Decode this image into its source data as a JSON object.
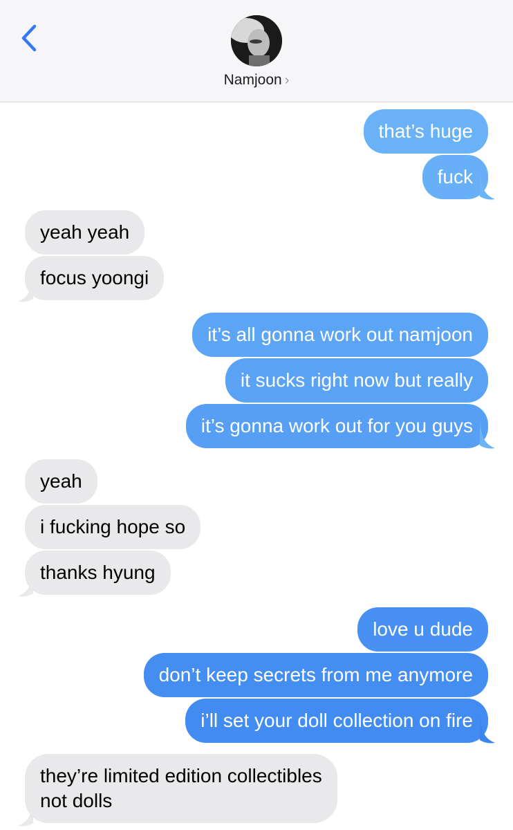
{
  "header": {
    "contact_name": "Namjoon",
    "chevron": "›",
    "back_icon": "chevron-left-icon",
    "accent": "#3478f6",
    "background": "#f6f6f8"
  },
  "colors": {
    "outgoing_top": "#6cb4f7",
    "outgoing_bottom": "#3a84f0",
    "incoming": "#e9e9eb"
  },
  "messages": [
    {
      "from": "me",
      "text": "that’s huge"
    },
    {
      "from": "me",
      "text": "fuck"
    },
    {
      "from": "them",
      "text": "yeah yeah"
    },
    {
      "from": "them",
      "text": "focus yoongi"
    },
    {
      "from": "me",
      "text": "it’s all gonna work out namjoon"
    },
    {
      "from": "me",
      "text": "it sucks right now but really"
    },
    {
      "from": "me",
      "text": "it’s gonna work out for you guys"
    },
    {
      "from": "them",
      "text": "yeah"
    },
    {
      "from": "them",
      "text": "i fucking hope so"
    },
    {
      "from": "them",
      "text": "thanks hyung"
    },
    {
      "from": "me",
      "text": "love u dude"
    },
    {
      "from": "me",
      "text": "don’t keep secrets from me anymore"
    },
    {
      "from": "me",
      "text": "i’ll set your doll collection on fire"
    },
    {
      "from": "them",
      "text": "they’re limited edition collectibles\nnot dolls"
    }
  ]
}
